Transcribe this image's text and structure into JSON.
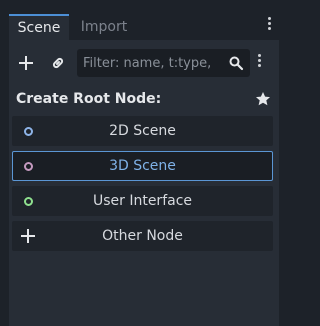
{
  "tabs": [
    {
      "label": "Scene"
    },
    {
      "label": "Import"
    }
  ],
  "search": {
    "placeholder": "Filter: name, t:type,"
  },
  "create_root": {
    "title": "Create Root Node:",
    "buttons": [
      {
        "label": "2D Scene",
        "icon": "node2d-circle-icon",
        "color": "#8eb4e8"
      },
      {
        "label": "3D Scene",
        "icon": "node3d-circle-icon",
        "color": "#c59ac0"
      },
      {
        "label": "User Interface",
        "icon": "control-circle-icon",
        "color": "#8fe08f"
      },
      {
        "label": "Other Node",
        "icon": "plus-icon",
        "color": "#e6e8eb"
      }
    ]
  },
  "colors": {
    "accent": "#4c8fd6",
    "background": "#1d2229",
    "panel": "#272d36"
  }
}
